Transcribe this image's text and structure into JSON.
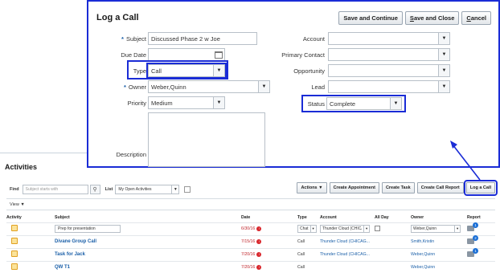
{
  "dialog": {
    "title": "Log a Call",
    "buttons": {
      "save_continue": "Save and Continue",
      "save_close_prefix": "S",
      "save_close_rest": "ave and Close",
      "cancel_prefix": "C",
      "cancel_rest": "ancel"
    },
    "left_fields": {
      "subject_label": "Subject",
      "subject_value": "Discussed Phase 2 w Joe",
      "due_date_label": "Due Date",
      "due_date_value": "",
      "type_label": "Type",
      "type_value": "Call",
      "owner_label": "Owner",
      "owner_value": "Weber,Quinn",
      "priority_label": "Priority",
      "priority_value": "Medium",
      "description_label": "Description"
    },
    "right_fields": {
      "account_label": "Account",
      "primary_contact_label": "Primary Contact",
      "opportunity_label": "Opportunity",
      "lead_label": "Lead",
      "status_label": "Status",
      "status_value": "Complete"
    },
    "required_marker": "*",
    "dropdown_glyph": "▼"
  },
  "activities": {
    "title": "Activities",
    "find_label": "Find",
    "find_placeholder": "Subject starts with",
    "list_label": "List",
    "list_value": "My Open Activities",
    "view_label": "View ▼",
    "toolbar": {
      "actions": "Actions ▼",
      "create_appointment": "Create Appointment",
      "create_task": "Create Task",
      "create_call_report": "Create Call Report",
      "log_call": "Log a Call"
    },
    "columns": [
      "Activity",
      "Subject",
      "Date",
      "Type",
      "Account",
      "All Day",
      "Owner",
      "Report"
    ],
    "rows": [
      {
        "subject": "Prep for presentation",
        "date": "6/30/16",
        "type": "Chat",
        "account": "Thunder Cloud (CHICAG...",
        "owner": "Weber,Quinn",
        "report_badge": "1",
        "editable": true,
        "overdue": true
      },
      {
        "subject": "Divane Group Call",
        "date": "7/15/16",
        "type": "Call",
        "account": "Thunder Cloud (CHICAG...",
        "owner": "Smith,Kristin",
        "report_badge": "2",
        "editable": false,
        "overdue": true
      },
      {
        "subject": "Task for Jack",
        "date": "7/20/16",
        "type": "Call",
        "account": "Thunder Cloud (CHICAG...",
        "owner": "Weber,Quinn",
        "report_badge": "1",
        "editable": false,
        "overdue": true
      },
      {
        "subject": "QW T1",
        "date": "7/20/16",
        "type": "Call",
        "account": "",
        "owner": "Weber,Quinn",
        "report_badge": "",
        "editable": false,
        "overdue": true
      }
    ],
    "error_glyph": "!"
  },
  "colors": {
    "highlight": "#1a2cd6",
    "link": "#1a5fa8",
    "overdue": "#c1272d"
  }
}
